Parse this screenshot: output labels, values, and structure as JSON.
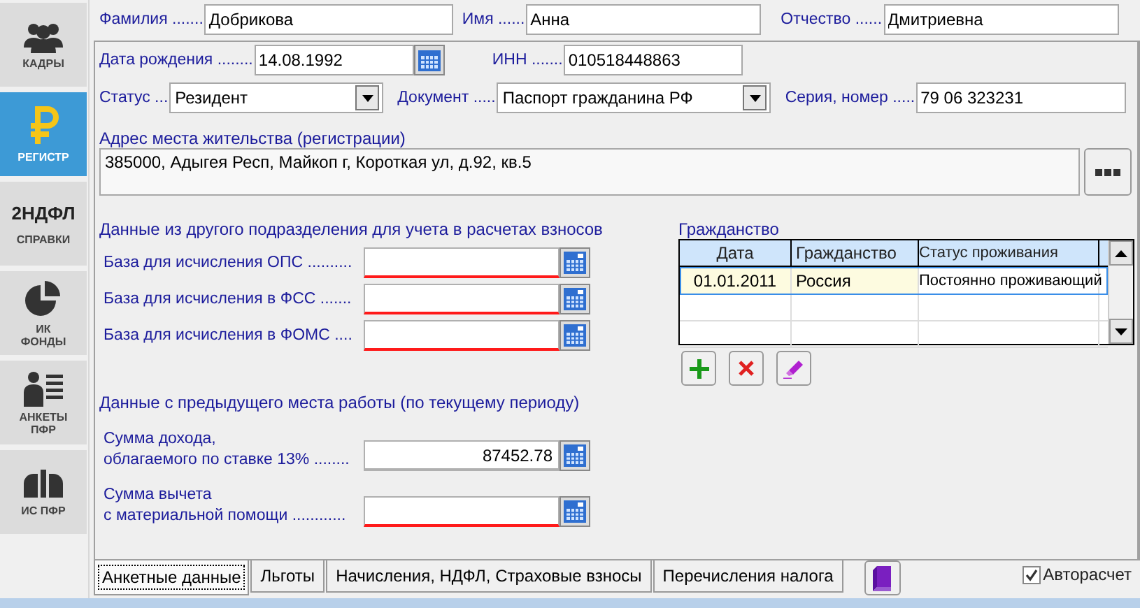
{
  "sidebar": {
    "items": [
      {
        "kind": "people",
        "label": "КАДРЫ",
        "selected": false
      },
      {
        "kind": "ruble",
        "label": "РЕГИСТР",
        "selected": true
      },
      {
        "kind": "text",
        "title": "2НДФЛ",
        "label": "СПРАВКИ",
        "selected": false
      },
      {
        "kind": "pie",
        "label": "ИК ФОНДЫ",
        "selected": false
      },
      {
        "kind": "form",
        "label": "АНКЕТЫ ПФР",
        "selected": false
      },
      {
        "kind": "logo",
        "label": "ИС ПФР",
        "selected": false
      }
    ]
  },
  "person": {
    "surname": {
      "label": "Фамилия .......",
      "value": "Добрикова"
    },
    "name": {
      "label": "Имя ......",
      "value": "Анна"
    },
    "patronymic": {
      "label": "Отчество ......",
      "value": "Дмитриевна"
    }
  },
  "birth_date": {
    "label": "Дата рождения ........",
    "value": "14.08.1992"
  },
  "inn": {
    "label": "ИНН .......",
    "value": "010518448863"
  },
  "status": {
    "label": "Статус ...",
    "value": "Резидент"
  },
  "document": {
    "label": "Документ .....",
    "value": "Паспорт гражданина РФ"
  },
  "series_number": {
    "label": "Серия, номер .....",
    "value": "79 06 323231"
  },
  "address": {
    "label": "Адрес места жительства (регистрации)",
    "value": "385000, Адыгея Респ, Майкоп г, Короткая ул, д.92, кв.5"
  },
  "other_division": {
    "title": "Данные из другого подразделения для учета в расчетах взносов",
    "fields": [
      {
        "label": "База для исчисления ОПС ..........",
        "invalid": true
      },
      {
        "label": "База для исчисления в ФСС .......",
        "invalid": true
      },
      {
        "label": "База для исчисления в ФОМС ....",
        "invalid": true
      }
    ]
  },
  "previous_job": {
    "title": "Данные с предыдущего места работы (по текущему периоду)",
    "fields": [
      {
        "label": "Сумма дохода,\nоблагаемого по ставке 13% ........",
        "value": "87452.78",
        "invalid": false
      },
      {
        "label": "Сумма вычета\nс материальной помощи ............",
        "invalid": true
      }
    ]
  },
  "citizenship": {
    "title": "Гражданство",
    "columns": [
      "Дата",
      "Гражданство",
      "Статус проживания"
    ],
    "rows": [
      {
        "cells": [
          "01.01.2011",
          "Россия",
          "Постоянно проживающий"
        ],
        "selected": true
      }
    ]
  },
  "tabs": [
    {
      "label": "Анкетные данные",
      "selected": true
    },
    {
      "label": "Льготы",
      "selected": false
    },
    {
      "label": "Начисления, НДФЛ, Страховые взносы",
      "selected": false
    },
    {
      "label": "Перечисления налога",
      "selected": false
    }
  ],
  "autocalc": {
    "label": "Авторасчет",
    "checked": true
  }
}
